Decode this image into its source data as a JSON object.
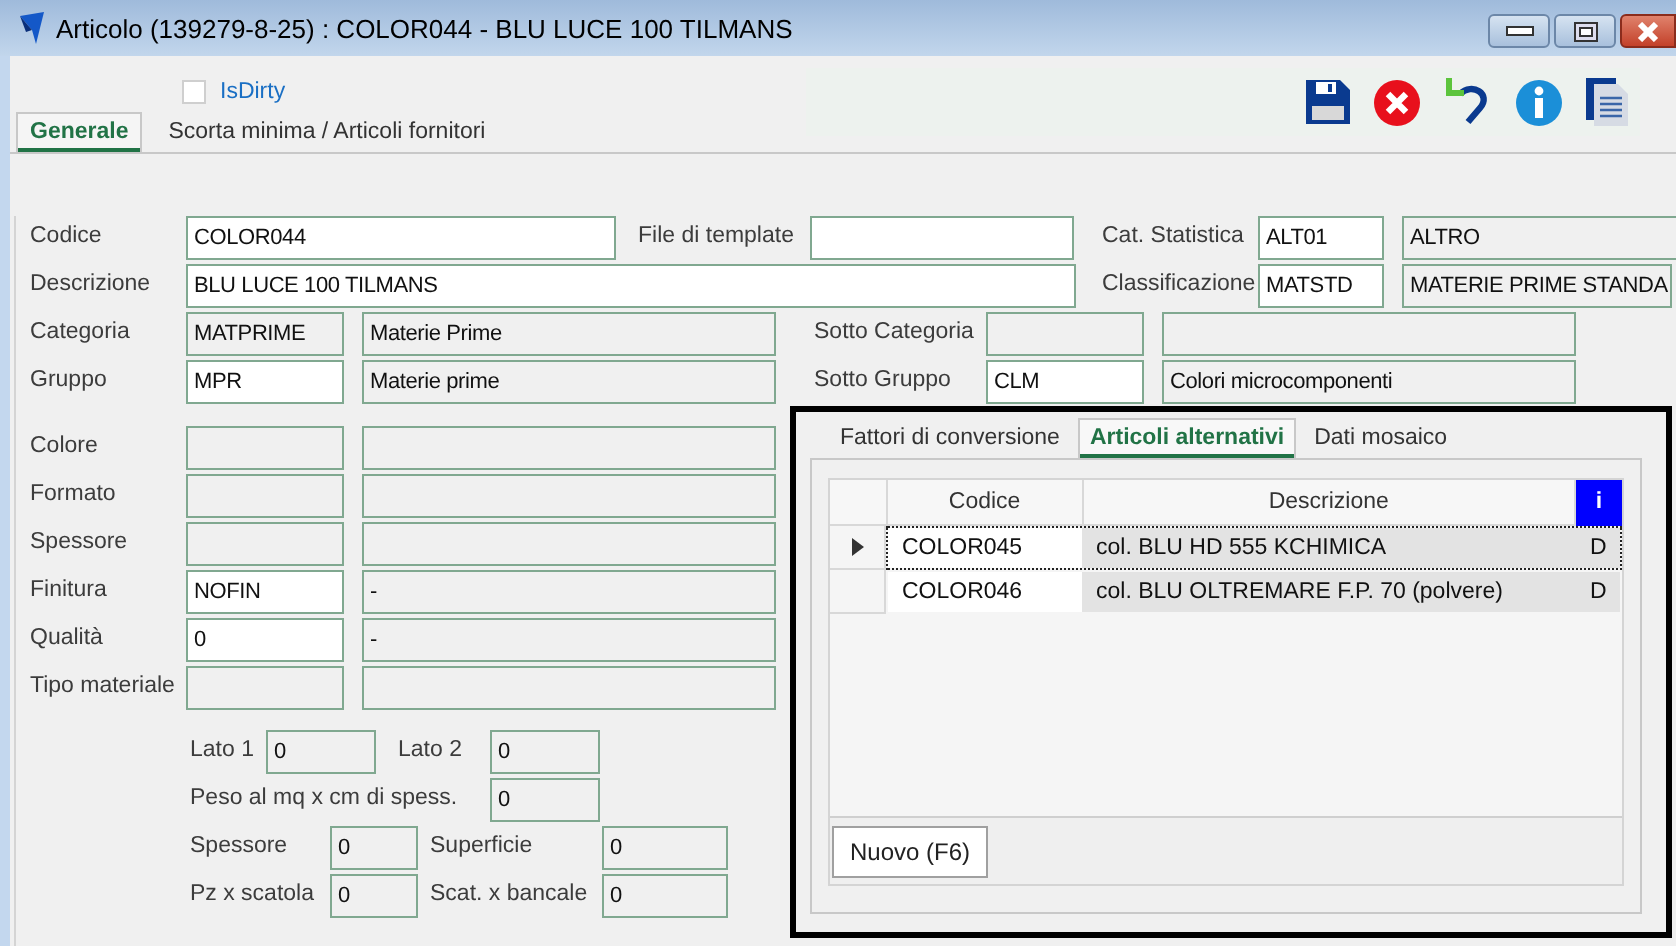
{
  "window": {
    "title": "Articolo (139279-8-25) : COLOR044 - BLU LUCE 100 TILMANS"
  },
  "is_dirty": {
    "label": "IsDirty",
    "checked": false
  },
  "tabs": [
    {
      "label": "Generale",
      "selected": true
    },
    {
      "label": "Scorta minima / Articoli fornitori",
      "selected": false
    }
  ],
  "form_rows": [
    {
      "items": [
        {
          "kind": "label",
          "text": "Codice"
        },
        {
          "kind": "field",
          "value": "COLOR044",
          "readonly": false
        },
        {
          "kind": "label",
          "text": "File di template"
        },
        {
          "kind": "field",
          "readonly": false
        },
        {
          "kind": "label",
          "text": "Cat. Statistica"
        },
        {
          "kind": "field",
          "value": "ALT01",
          "readonly": false
        },
        {
          "kind": "field",
          "value": "ALTRO",
          "readonly": true
        }
      ]
    },
    {
      "items": [
        {
          "kind": "label",
          "text": "Descrizione"
        },
        {
          "kind": "field",
          "value": "BLU LUCE 100 TILMANS",
          "readonly": false
        },
        {
          "kind": "label",
          "text": "Classificazione"
        },
        {
          "kind": "field",
          "value": "MATSTD",
          "readonly": false
        },
        {
          "kind": "field",
          "value": "MATERIE PRIME STANDA",
          "readonly": true
        }
      ]
    },
    {
      "items": [
        {
          "kind": "label",
          "text": "Categoria"
        },
        {
          "kind": "field",
          "value": "MATPRIME",
          "readonly": true
        },
        {
          "kind": "field",
          "value": "Materie Prime",
          "readonly": true
        },
        {
          "kind": "label",
          "text": "Sotto Categoria"
        },
        {
          "kind": "field",
          "readonly": true
        },
        {
          "kind": "field",
          "readonly": true
        }
      ]
    },
    {
      "items": [
        {
          "kind": "label",
          "text": "Gruppo"
        },
        {
          "kind": "field",
          "value": "MPR",
          "readonly": false
        },
        {
          "kind": "field",
          "value": "Materie prime",
          "readonly": true
        },
        {
          "kind": "label",
          "text": "Sotto Gruppo"
        },
        {
          "kind": "field",
          "value": "CLM",
          "readonly": false
        },
        {
          "kind": "field",
          "value": "Colori microcomponenti",
          "readonly": true
        }
      ]
    },
    {
      "items": [
        {
          "kind": "label",
          "text": "Colore"
        },
        {
          "kind": "field",
          "readonly": true
        },
        {
          "kind": "field",
          "readonly": true
        }
      ]
    },
    {
      "items": [
        {
          "kind": "label",
          "text": "Formato"
        },
        {
          "kind": "field",
          "readonly": true
        },
        {
          "kind": "field",
          "readonly": true
        }
      ]
    },
    {
      "items": [
        {
          "kind": "label",
          "text": "Spessore"
        },
        {
          "kind": "field",
          "readonly": true
        },
        {
          "kind": "field",
          "readonly": true
        }
      ]
    },
    {
      "items": [
        {
          "kind": "label",
          "text": "Finitura"
        },
        {
          "kind": "field",
          "value": "NOFIN",
          "readonly": false
        },
        {
          "kind": "field",
          "value": "-",
          "readonly": true
        }
      ]
    },
    {
      "items": [
        {
          "kind": "label",
          "text": "Qualità"
        },
        {
          "kind": "field",
          "value": "0",
          "readonly": false
        },
        {
          "kind": "field",
          "value": "-",
          "readonly": true
        }
      ]
    },
    {
      "items": [
        {
          "kind": "label",
          "text": "Tipo materiale"
        },
        {
          "kind": "field",
          "readonly": true
        },
        {
          "kind": "field",
          "readonly": true
        }
      ]
    },
    {
      "items": [
        {
          "kind": "label",
          "text": "Lato 1"
        },
        {
          "kind": "field",
          "value": "0",
          "readonly": true
        },
        {
          "kind": "label",
          "text": "Lato 2"
        },
        {
          "kind": "field",
          "value": "0",
          "readonly": true
        }
      ]
    },
    {
      "items": [
        {
          "kind": "label",
          "text": "Peso al mq x cm di spess."
        },
        {
          "kind": "field",
          "value": "0",
          "readonly": true
        }
      ]
    },
    {
      "items": [
        {
          "kind": "label",
          "text": "Spessore"
        },
        {
          "kind": "field",
          "value": "0",
          "readonly": true
        },
        {
          "kind": "label",
          "text": "Superficie"
        },
        {
          "kind": "field",
          "value": "0",
          "readonly": true
        }
      ]
    },
    {
      "items": [
        {
          "kind": "label",
          "text": "Pz x scatola"
        },
        {
          "kind": "field",
          "value": "0",
          "readonly": true
        },
        {
          "kind": "label",
          "text": "Scat. x bancale"
        },
        {
          "kind": "field",
          "value": "0",
          "readonly": true
        }
      ]
    }
  ],
  "alt_panel": {
    "tabs": [
      {
        "label": "Fattori di conversione",
        "selected": false
      },
      {
        "label": "Articoli alternativi",
        "selected": true
      },
      {
        "label": "Dati mosaico",
        "selected": false
      }
    ],
    "table": {
      "columns": [
        "Codice",
        "Descrizione",
        "i"
      ],
      "rows": [
        {
          "selected": true,
          "cells": [
            "COLOR045",
            "col. BLU HD 555 KCHIMICA",
            "D"
          ]
        },
        {
          "selected": false,
          "cells": [
            "COLOR046",
            "col. BLU OLTREMARE F.P. 70 (polvere)",
            "D"
          ]
        }
      ]
    },
    "new_button": "Nuovo (F6)"
  }
}
